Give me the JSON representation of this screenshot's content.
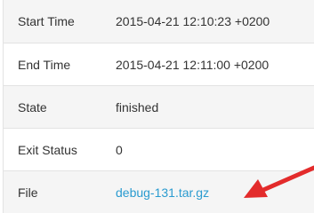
{
  "details": {
    "rows": [
      {
        "label": "Start Time",
        "value": "2015-04-21 12:10:23 +0200"
      },
      {
        "label": "End Time",
        "value": "2015-04-21 12:11:00 +0200"
      },
      {
        "label": "State",
        "value": "finished"
      },
      {
        "label": "Exit Status",
        "value": "0"
      },
      {
        "label": "File",
        "value": "debug-131.tar.gz"
      }
    ]
  },
  "colors": {
    "link": "#2a9bd0",
    "arrow": "#e32b2b",
    "stripe": "#f5f5f5",
    "border": "#e3e3e3"
  },
  "icons": {
    "annotation": "red-arrow-icon"
  }
}
